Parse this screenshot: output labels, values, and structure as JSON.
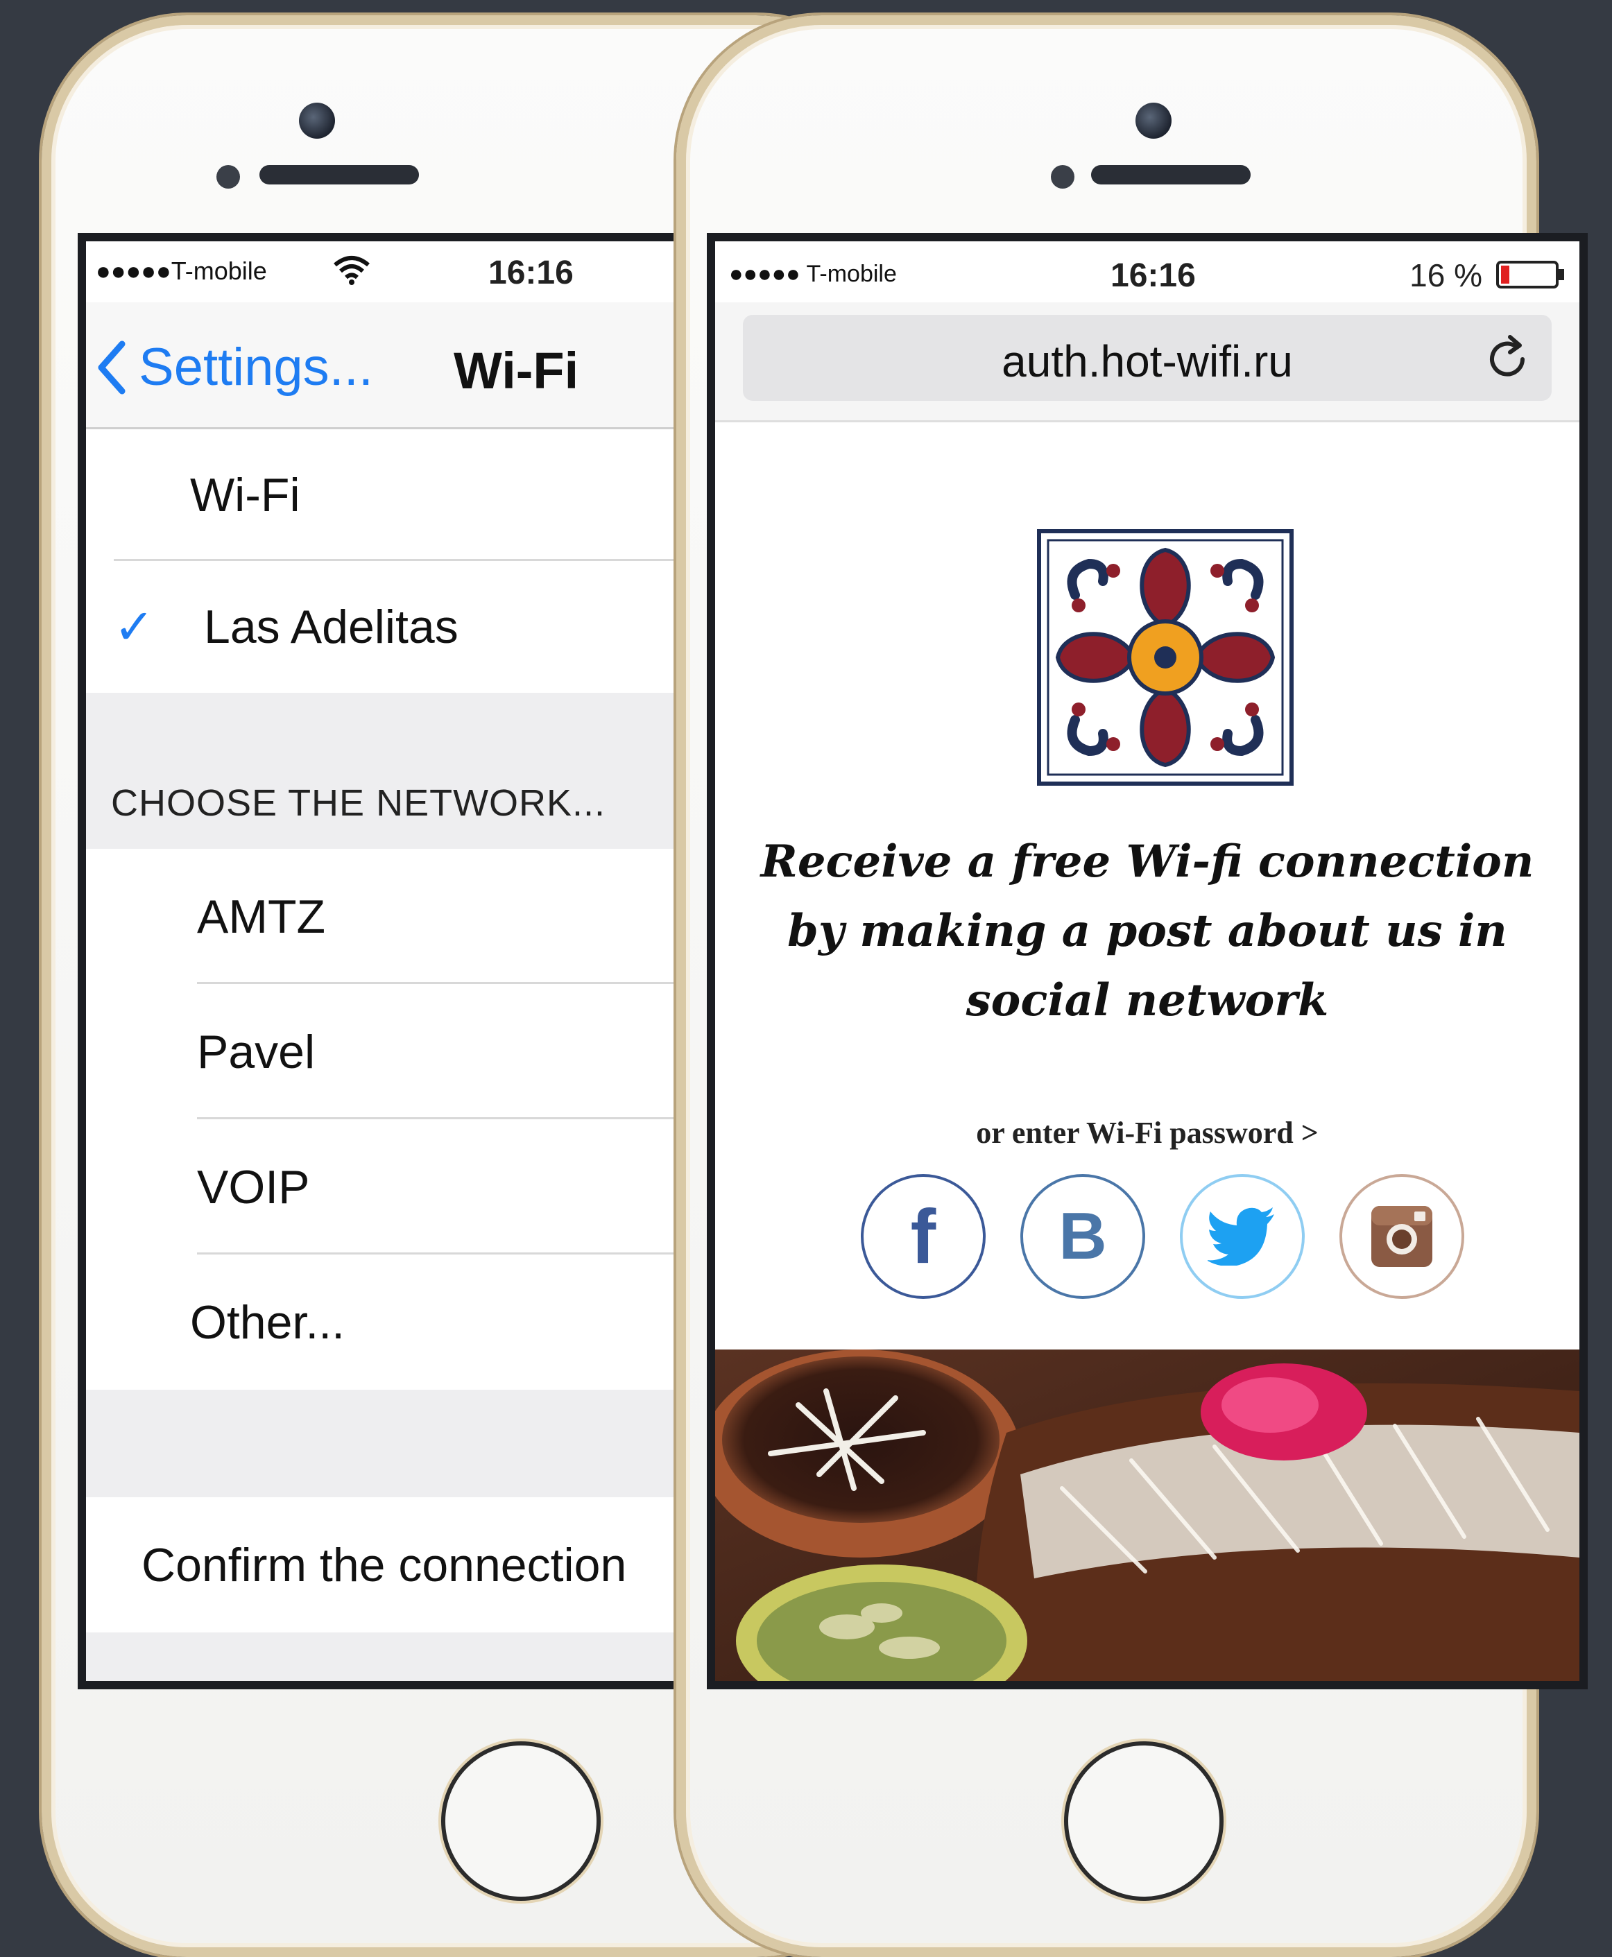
{
  "left_phone": {
    "status": {
      "carrier": "●●●●●T-mobile",
      "time": "16:16"
    },
    "nav": {
      "back_label": "Settings...",
      "title": "Wi-Fi"
    },
    "wifi_row": {
      "label": "Wi-Fi"
    },
    "connected_network": {
      "label": "Las Adelitas",
      "check": "✓"
    },
    "section_header": "CHOOSE THE NETWORK...",
    "networks": [
      {
        "label": "AMTZ"
      },
      {
        "label": "Pavel"
      },
      {
        "label": "VOIP"
      },
      {
        "label": "Other..."
      }
    ],
    "confirm_label": "Confirm the connection"
  },
  "right_phone": {
    "status": {
      "carrier": "●●●●● T-mobile",
      "time": "16:16",
      "battery": "16 %"
    },
    "url": "auth.hot-wifi.ru",
    "promo_text": "Receive a free Wi-fi connection by making a post about us in social network",
    "password_link": "or enter Wi-Fi password >",
    "social": [
      {
        "name": "facebook-icon",
        "glyph": "f",
        "color": "#3b5998"
      },
      {
        "name": "vk-icon",
        "glyph": "B",
        "color": "#4a76a8"
      },
      {
        "name": "twitter-icon",
        "glyph": "",
        "color": "#1da1f2"
      },
      {
        "name": "instagram-icon",
        "glyph": "",
        "color": "#8a5a44"
      }
    ]
  },
  "colors": {
    "ios_blue": "#1e7cf2",
    "tile_navy": "#1f2f57",
    "tile_red": "#8e1f2b",
    "tile_orange": "#f0a020"
  }
}
